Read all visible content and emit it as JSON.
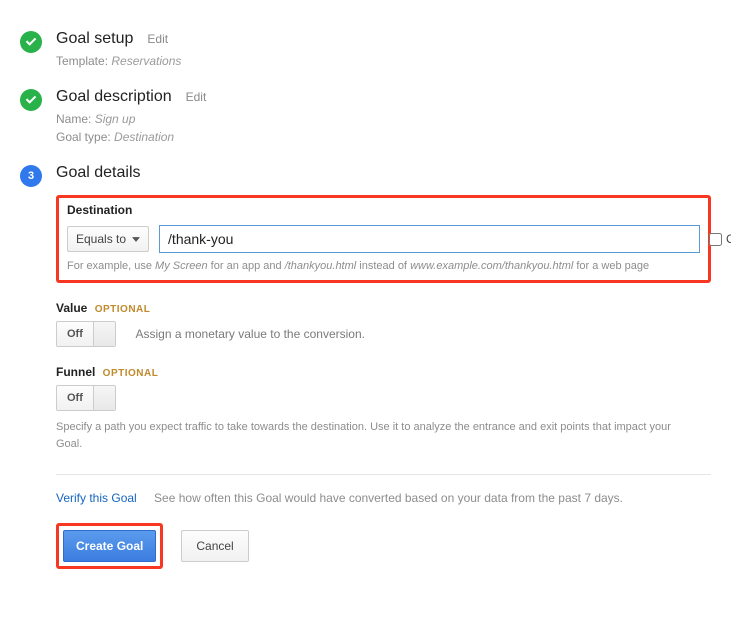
{
  "steps": {
    "setup": {
      "title": "Goal setup",
      "edit": "Edit",
      "template_label": "Template:",
      "template_value": "Reservations"
    },
    "description": {
      "title": "Goal description",
      "edit": "Edit",
      "name_label": "Name:",
      "name_value": "Sign up",
      "type_label": "Goal type:",
      "type_value": "Destination"
    },
    "details": {
      "number": "3",
      "title": "Goal details"
    }
  },
  "destination": {
    "label": "Destination",
    "match_mode": "Equals to",
    "value": "/thank-you",
    "case_sensitive_label": "Case sensitive",
    "hint_prefix": "For example, use ",
    "hint_app": "My Screen",
    "hint_mid1": " for an app and ",
    "hint_path": "/thankyou.html",
    "hint_mid2": " instead of ",
    "hint_full": "www.example.com/thankyou.html",
    "hint_suffix": " for a web page"
  },
  "value": {
    "label": "Value",
    "optional": "OPTIONAL",
    "toggle": "Off",
    "desc": "Assign a monetary value to the conversion."
  },
  "funnel": {
    "label": "Funnel",
    "optional": "OPTIONAL",
    "toggle": "Off",
    "desc": "Specify a path you expect traffic to take towards the destination. Use it to analyze the entrance and exit points that impact your Goal."
  },
  "verify": {
    "link": "Verify this Goal",
    "desc": "See how often this Goal would have converted based on your data from the past 7 days."
  },
  "buttons": {
    "create": "Create Goal",
    "cancel": "Cancel"
  }
}
